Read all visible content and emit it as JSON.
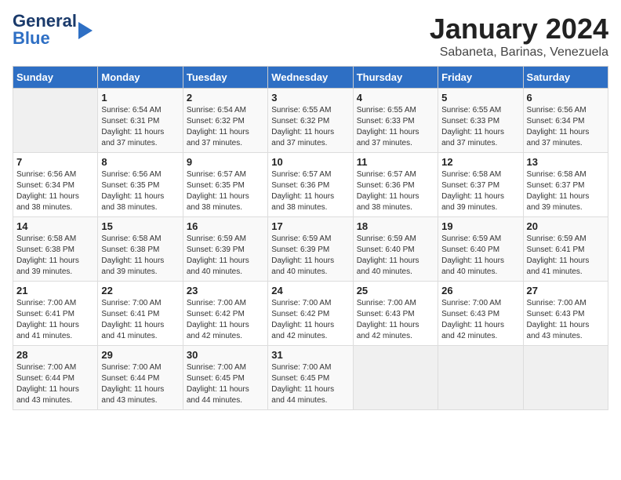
{
  "logo": {
    "line1": "General",
    "line2": "Blue"
  },
  "title": "January 2024",
  "subtitle": "Sabaneta, Barinas, Venezuela",
  "days_of_week": [
    "Sunday",
    "Monday",
    "Tuesday",
    "Wednesday",
    "Thursday",
    "Friday",
    "Saturday"
  ],
  "weeks": [
    [
      {
        "num": "",
        "info": ""
      },
      {
        "num": "1",
        "info": "Sunrise: 6:54 AM\nSunset: 6:31 PM\nDaylight: 11 hours\nand 37 minutes."
      },
      {
        "num": "2",
        "info": "Sunrise: 6:54 AM\nSunset: 6:32 PM\nDaylight: 11 hours\nand 37 minutes."
      },
      {
        "num": "3",
        "info": "Sunrise: 6:55 AM\nSunset: 6:32 PM\nDaylight: 11 hours\nand 37 minutes."
      },
      {
        "num": "4",
        "info": "Sunrise: 6:55 AM\nSunset: 6:33 PM\nDaylight: 11 hours\nand 37 minutes."
      },
      {
        "num": "5",
        "info": "Sunrise: 6:55 AM\nSunset: 6:33 PM\nDaylight: 11 hours\nand 37 minutes."
      },
      {
        "num": "6",
        "info": "Sunrise: 6:56 AM\nSunset: 6:34 PM\nDaylight: 11 hours\nand 37 minutes."
      }
    ],
    [
      {
        "num": "7",
        "info": "Sunrise: 6:56 AM\nSunset: 6:34 PM\nDaylight: 11 hours\nand 38 minutes."
      },
      {
        "num": "8",
        "info": "Sunrise: 6:56 AM\nSunset: 6:35 PM\nDaylight: 11 hours\nand 38 minutes."
      },
      {
        "num": "9",
        "info": "Sunrise: 6:57 AM\nSunset: 6:35 PM\nDaylight: 11 hours\nand 38 minutes."
      },
      {
        "num": "10",
        "info": "Sunrise: 6:57 AM\nSunset: 6:36 PM\nDaylight: 11 hours\nand 38 minutes."
      },
      {
        "num": "11",
        "info": "Sunrise: 6:57 AM\nSunset: 6:36 PM\nDaylight: 11 hours\nand 38 minutes."
      },
      {
        "num": "12",
        "info": "Sunrise: 6:58 AM\nSunset: 6:37 PM\nDaylight: 11 hours\nand 39 minutes."
      },
      {
        "num": "13",
        "info": "Sunrise: 6:58 AM\nSunset: 6:37 PM\nDaylight: 11 hours\nand 39 minutes."
      }
    ],
    [
      {
        "num": "14",
        "info": "Sunrise: 6:58 AM\nSunset: 6:38 PM\nDaylight: 11 hours\nand 39 minutes."
      },
      {
        "num": "15",
        "info": "Sunrise: 6:58 AM\nSunset: 6:38 PM\nDaylight: 11 hours\nand 39 minutes."
      },
      {
        "num": "16",
        "info": "Sunrise: 6:59 AM\nSunset: 6:39 PM\nDaylight: 11 hours\nand 40 minutes."
      },
      {
        "num": "17",
        "info": "Sunrise: 6:59 AM\nSunset: 6:39 PM\nDaylight: 11 hours\nand 40 minutes."
      },
      {
        "num": "18",
        "info": "Sunrise: 6:59 AM\nSunset: 6:40 PM\nDaylight: 11 hours\nand 40 minutes."
      },
      {
        "num": "19",
        "info": "Sunrise: 6:59 AM\nSunset: 6:40 PM\nDaylight: 11 hours\nand 40 minutes."
      },
      {
        "num": "20",
        "info": "Sunrise: 6:59 AM\nSunset: 6:41 PM\nDaylight: 11 hours\nand 41 minutes."
      }
    ],
    [
      {
        "num": "21",
        "info": "Sunrise: 7:00 AM\nSunset: 6:41 PM\nDaylight: 11 hours\nand 41 minutes."
      },
      {
        "num": "22",
        "info": "Sunrise: 7:00 AM\nSunset: 6:41 PM\nDaylight: 11 hours\nand 41 minutes."
      },
      {
        "num": "23",
        "info": "Sunrise: 7:00 AM\nSunset: 6:42 PM\nDaylight: 11 hours\nand 42 minutes."
      },
      {
        "num": "24",
        "info": "Sunrise: 7:00 AM\nSunset: 6:42 PM\nDaylight: 11 hours\nand 42 minutes."
      },
      {
        "num": "25",
        "info": "Sunrise: 7:00 AM\nSunset: 6:43 PM\nDaylight: 11 hours\nand 42 minutes."
      },
      {
        "num": "26",
        "info": "Sunrise: 7:00 AM\nSunset: 6:43 PM\nDaylight: 11 hours\nand 42 minutes."
      },
      {
        "num": "27",
        "info": "Sunrise: 7:00 AM\nSunset: 6:43 PM\nDaylight: 11 hours\nand 43 minutes."
      }
    ],
    [
      {
        "num": "28",
        "info": "Sunrise: 7:00 AM\nSunset: 6:44 PM\nDaylight: 11 hours\nand 43 minutes."
      },
      {
        "num": "29",
        "info": "Sunrise: 7:00 AM\nSunset: 6:44 PM\nDaylight: 11 hours\nand 43 minutes."
      },
      {
        "num": "30",
        "info": "Sunrise: 7:00 AM\nSunset: 6:45 PM\nDaylight: 11 hours\nand 44 minutes."
      },
      {
        "num": "31",
        "info": "Sunrise: 7:00 AM\nSunset: 6:45 PM\nDaylight: 11 hours\nand 44 minutes."
      },
      {
        "num": "",
        "info": ""
      },
      {
        "num": "",
        "info": ""
      },
      {
        "num": "",
        "info": ""
      }
    ]
  ]
}
